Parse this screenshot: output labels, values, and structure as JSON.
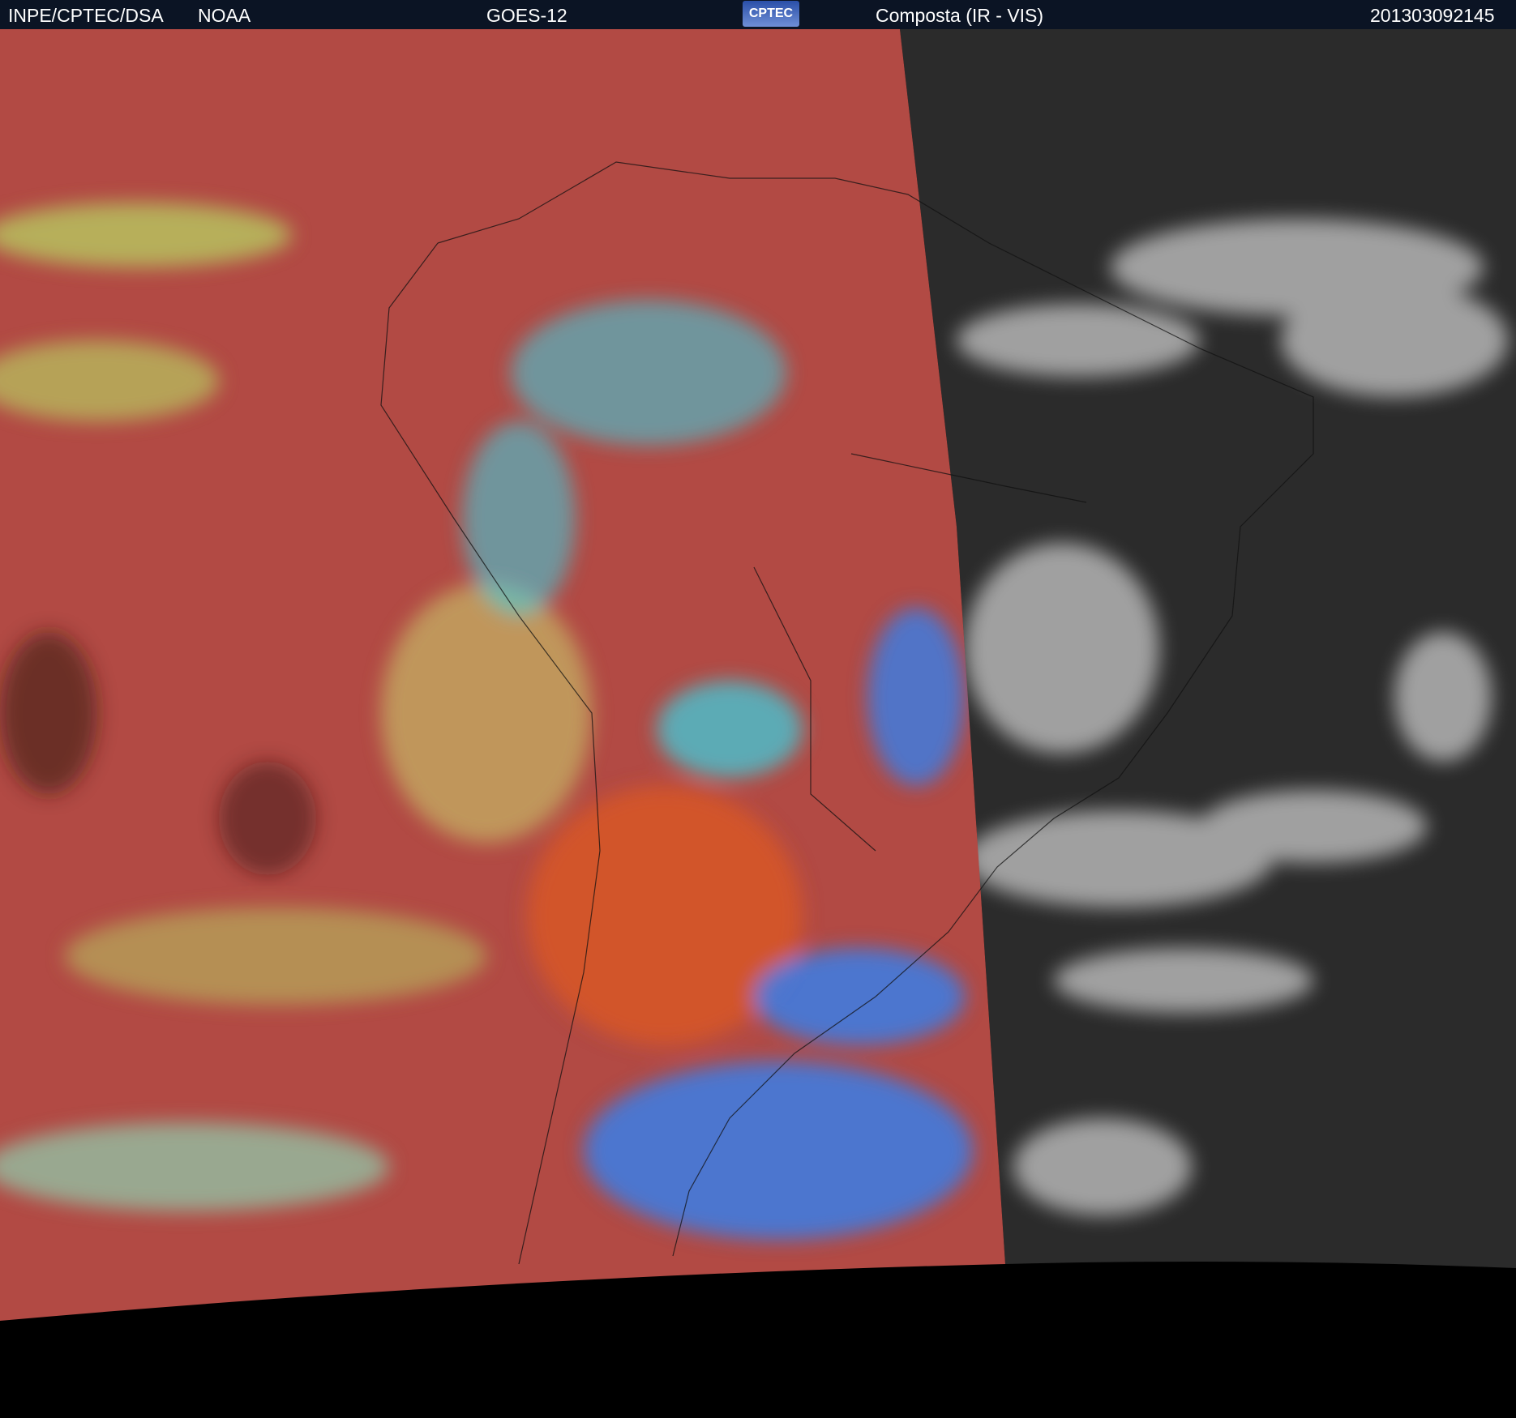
{
  "header": {
    "org": "INPE/CPTEC/DSA",
    "agency": "NOAA",
    "satellite": "GOES-12",
    "logo_text": "CPTEC",
    "product": "Composta (IR - VIS)",
    "timestamp": "201303092145"
  },
  "colors": {
    "header_bg": "#0b1424",
    "ir_red": "#b24a44",
    "ir_orange": "#d2552c",
    "ir_cyan": "#39d4e6",
    "ir_blue": "#3a7ee8",
    "ir_yellowgreen": "#b8c860",
    "vis_background": "#2b2b2b",
    "vis_cloud": "#c8c8c8"
  }
}
